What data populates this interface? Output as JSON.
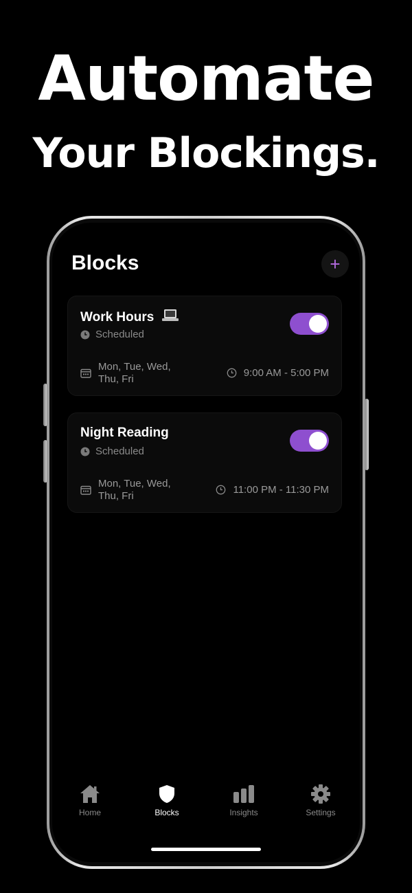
{
  "headline": {
    "line1": "Automate",
    "line2": "Your Blockings."
  },
  "screen": {
    "title": "Blocks",
    "add_label": "+"
  },
  "blocks": [
    {
      "title": "Work Hours",
      "status": "Scheduled",
      "days_line1": "Mon, Tue, Wed,",
      "days_line2": "Thu, Fri",
      "time": "9:00 AM - 5:00 PM",
      "enabled": true,
      "icon": "laptop-icon"
    },
    {
      "title": "Night Reading",
      "status": "Scheduled",
      "days_line1": "Mon, Tue, Wed,",
      "days_line2": "Thu, Fri",
      "time": "11:00 PM - 11:30 PM",
      "enabled": true
    }
  ],
  "tabs": [
    {
      "label": "Home",
      "icon": "house-icon",
      "active": false
    },
    {
      "label": "Blocks",
      "icon": "shield-icon",
      "active": true
    },
    {
      "label": "Insights",
      "icon": "bar-chart-icon",
      "active": false
    },
    {
      "label": "Settings",
      "icon": "gear-icon",
      "active": false
    }
  ],
  "colors": {
    "accent": "#8e4fcf",
    "plus": "#b46be0",
    "background": "#000000",
    "muted_text": "#8a8a8a"
  }
}
